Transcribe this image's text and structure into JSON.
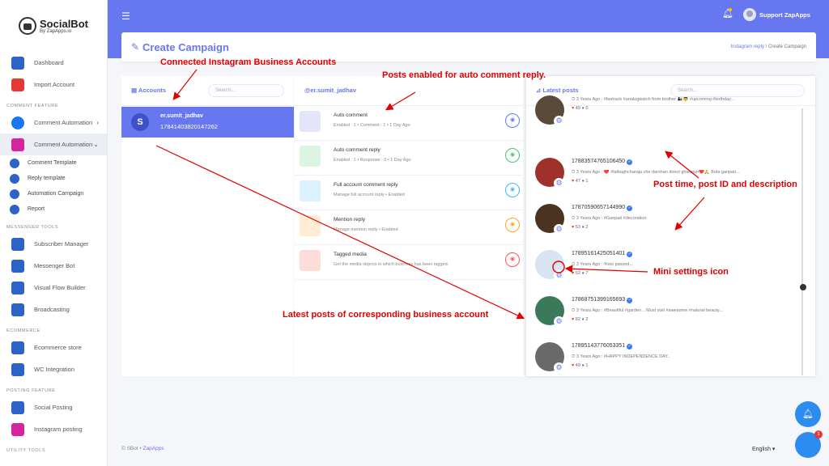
{
  "brand": {
    "name": "SocialBot",
    "sub": "By ZapApps.io"
  },
  "sidebar": {
    "top": [
      {
        "label": "Dashboard",
        "icon": "bar-chart-icon",
        "color": "#2b63c9"
      },
      {
        "label": "Import Account",
        "icon": "flag-icon",
        "color": "#e53935"
      }
    ],
    "comment_feature": "COMMENT FEATURE",
    "comment_items": [
      {
        "label": "Comment Automation",
        "icon": "facebook-icon",
        "color": "#1877f2"
      },
      {
        "label": "Comment Automation",
        "icon": "instagram-icon",
        "color": "#d6249f"
      }
    ],
    "sub_items": [
      "Comment Template",
      "Reply template",
      "Automation Campaign",
      "Report"
    ],
    "messenger_tools": "MESSENGER TOOLS",
    "messenger_items": [
      {
        "label": "Subscriber Manager",
        "icon": "users-icon",
        "color": "#2b63c9"
      },
      {
        "label": "Messenger Bot",
        "icon": "robot-icon",
        "color": "#2b63c9"
      },
      {
        "label": "Visual Flow Builder",
        "icon": "flow-icon",
        "color": "#2b63c9"
      },
      {
        "label": "Broadcasting",
        "icon": "clock-icon",
        "color": "#2b63c9"
      }
    ],
    "ecommerce": "ECOMMERCE",
    "ecommerce_items": [
      {
        "label": "Ecommerce store",
        "icon": "store-icon",
        "color": "#2b63c9"
      },
      {
        "label": "WC Integration",
        "icon": "wordpress-icon",
        "color": "#2b63c9"
      }
    ],
    "posting_feature": "POSTING FEATURE",
    "posting_items": [
      {
        "label": "Social Posting",
        "icon": "posting-icon",
        "color": "#2b63c9"
      },
      {
        "label": "Instagram posting",
        "icon": "instagram-icon",
        "color": "#d6249f"
      }
    ],
    "utility_tools": "UTILITY TOOLS"
  },
  "topbar": {
    "user": "Support ZapApps"
  },
  "header": {
    "title": "Create Campaign",
    "crumb_link": "Instagram reply",
    "crumb_sep": "/",
    "crumb_current": "Create Campaign"
  },
  "accounts": {
    "title": "Accounts",
    "search_placeholder": "Search...",
    "items": [
      {
        "initial": "S",
        "name": "er.sumit_jadhav",
        "id": "17841403820147262"
      }
    ]
  },
  "features": {
    "title": "@er.sumit_jadhav",
    "items": [
      {
        "title": "Auto comment",
        "sub": "Enabled : 1 • Comment : 1 • 1 Day Ago",
        "color": "#6777ef",
        "bg": "#e3e6fb"
      },
      {
        "title": "Auto comment reply",
        "sub": "Enabled : 1 • Response : 0 • 1 Day Ago",
        "color": "#47c363",
        "bg": "#dcf5e2"
      },
      {
        "title": "Full account comment reply",
        "sub": "Manage full account reply • Enabled",
        "color": "#3abaf4",
        "bg": "#dbf1fd"
      },
      {
        "title": "Mention reply",
        "sub": "Manage mention reply • Enabled",
        "color": "#ffa426",
        "bg": "#ffecd3"
      },
      {
        "title": "Tagged media",
        "sub": "Get the media objects in which business has been tagged.",
        "color": "#fc544b",
        "bg": "#fedcda"
      }
    ]
  },
  "posts": {
    "title": "Latest posts",
    "search_placeholder": "Search...",
    "items": [
      {
        "id": "",
        "desc": "3 Years Ago : #fastrack #analogwatch from brother 👨‍👧👨 #upcoming #birthday...",
        "likes": "49",
        "comments": "0",
        "color": "#5a4a3a"
      },
      {
        "id": "17883574765106450",
        "desc": "3 Years Ago : ❤️ #lalbaghcharaja che darshan direct gharatun❤️🙏 Bola ganpati...",
        "likes": "47",
        "comments": "1",
        "color": "#a0302a"
      },
      {
        "id": "17870590657144990",
        "desc": "3 Years Ago : #Ganpati #decoration",
        "likes": "53",
        "comments": "2",
        "color": "#4a3420"
      },
      {
        "id": "17895161425051401",
        "desc": "3 Years Ago : Yooo passed...",
        "likes": "52",
        "comments": "7",
        "color": "#d8e4f0"
      },
      {
        "id": "17868751399165693",
        "desc": "3 Years Ago : #Beautiful #garden... Must visit #awesome #natural beauty...",
        "likes": "82",
        "comments": "2",
        "color": "#3a7a5a"
      },
      {
        "id": "17895143776053351",
        "desc": "3 Years Ago : #HAPPY INDEPENDENCE DAY..",
        "likes": "49",
        "comments": "1",
        "color": "#6a6a6a"
      }
    ]
  },
  "annotations": {
    "connected": "Connected Instagram Business Accounts",
    "enabled": "Posts enabled for auto comment reply.",
    "post_time": "Post time, post ID and description",
    "mini_settings": "Mini settings icon",
    "latest": "Latest posts of corresponding business account"
  },
  "footer": {
    "copy": "© SBot •",
    "link": "ZapApps",
    "lang": "English ▾"
  },
  "fab": {
    "badge": "1"
  }
}
